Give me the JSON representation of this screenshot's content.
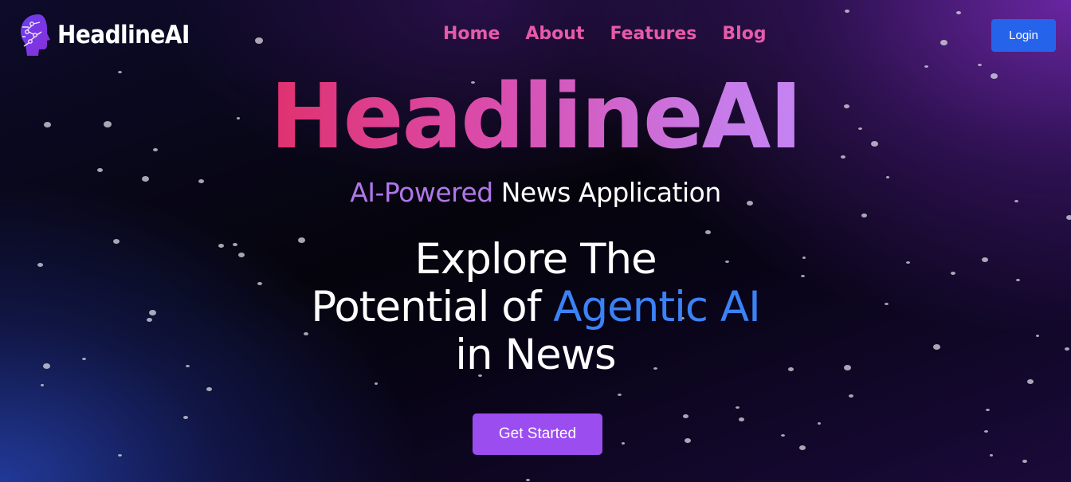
{
  "brand": {
    "name": "HeadlineAI",
    "logo_icon": "ai-head-logo-icon"
  },
  "nav": {
    "items": [
      {
        "label": "Home"
      },
      {
        "label": "About"
      },
      {
        "label": "Features"
      },
      {
        "label": "Blog"
      }
    ]
  },
  "header": {
    "login_label": "Login"
  },
  "hero": {
    "title": "HeadlineAI",
    "tagline_accent": "AI-Powered",
    "tagline_rest": " News Application",
    "headline_line1": "Explore The",
    "headline_line2_start": "Potential of ",
    "headline_line2_accent": "Agentic AI",
    "headline_line3": "in News",
    "cta_label": "Get Started"
  },
  "colors": {
    "nav_link": "#e85aa9",
    "login_button": "#2563eb",
    "cta_button": "#9b4df0",
    "accent_purple": "#b077e8",
    "accent_blue": "#3b82f6",
    "title_gradient_start": "#e0316f",
    "title_gradient_end": "#c483f2"
  }
}
